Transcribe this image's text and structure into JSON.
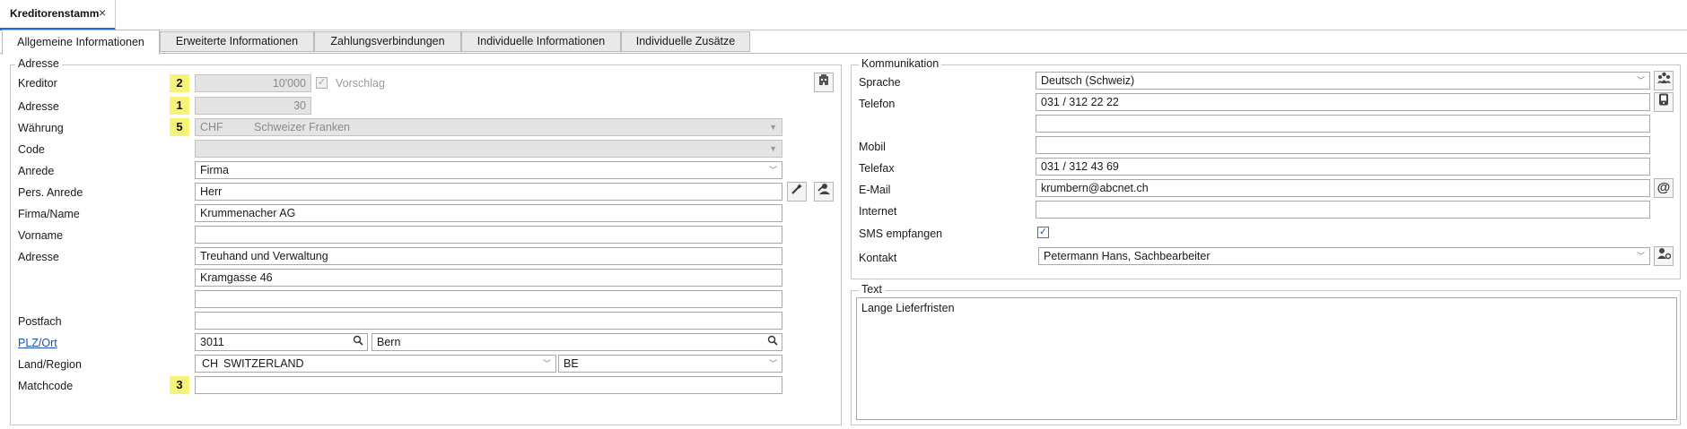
{
  "doc_tab": {
    "label": "Kreditorenstamm",
    "close": "×"
  },
  "tabs": [
    {
      "label": "Allgemeine Informationen"
    },
    {
      "label": "Erweiterte Informationen"
    },
    {
      "label": "Zahlungsverbindungen"
    },
    {
      "label": "Individuelle Informationen"
    },
    {
      "label": "Individuelle Zusätze"
    }
  ],
  "adresse": {
    "title": "Adresse",
    "kreditor": {
      "label": "Kreditor",
      "badge": "2",
      "value": "10'000",
      "vorschlag_label": "Vorschlag",
      "vorschlag_checked": true
    },
    "adresse_nr": {
      "label": "Adresse",
      "badge": "1",
      "value": "30"
    },
    "waehrung": {
      "label": "Währung",
      "badge": "5",
      "code": "CHF",
      "name": "Schweizer Franken"
    },
    "code": {
      "label": "Code",
      "value": ""
    },
    "anrede": {
      "label": "Anrede",
      "value": "Firma"
    },
    "pers_anrede": {
      "label": "Pers. Anrede",
      "value": "Herr"
    },
    "firma": {
      "label": "Firma/Name",
      "value": "Krummenacher AG"
    },
    "vorname": {
      "label": "Vorname",
      "value": ""
    },
    "adresse_text": {
      "label": "Adresse",
      "line1": "Treuhand und Verwaltung",
      "line2": "Kramgasse 46",
      "line3": ""
    },
    "postfach": {
      "label": "Postfach",
      "value": ""
    },
    "plz_ort": {
      "label": "PLZ/Ort",
      "plz": "3011",
      "ort": "Bern"
    },
    "land": {
      "label": "Land/Region",
      "code": "CH",
      "name": "SWITZERLAND",
      "region": "BE"
    },
    "matchcode": {
      "label": "Matchcode",
      "badge": "3",
      "value": ""
    }
  },
  "kommunikation": {
    "title": "Kommunikation",
    "sprache": {
      "label": "Sprache",
      "value": "Deutsch (Schweiz)"
    },
    "telefon": {
      "label": "Telefon",
      "value": "031 / 312 22 22",
      "value2": ""
    },
    "mobil": {
      "label": "Mobil",
      "value": ""
    },
    "telefax": {
      "label": "Telefax",
      "value": "031 / 312 43 69"
    },
    "email": {
      "label": "E-Mail",
      "value": "krumbern@abcnet.ch",
      "icon": "@"
    },
    "internet": {
      "label": "Internet",
      "value": ""
    },
    "sms": {
      "label": "SMS empfangen",
      "checked": true
    },
    "kontakt": {
      "label": "Kontakt",
      "value": "Petermann Hans, Sachbearbeiter"
    }
  },
  "text_group": {
    "title": "Text",
    "value": "Lange Lieferfristen"
  },
  "icons": {
    "building": "building-icon",
    "wand": "wand-icon",
    "person_edit": "person-edit-icon",
    "people": "people-icon",
    "phone": "phone-icon",
    "at": "at-icon",
    "person_gear": "person-gear-icon",
    "search": "search-icon",
    "chevron": "chevron-down-icon",
    "check": "check-icon"
  },
  "colors": {
    "accent": "#1e6fd0",
    "badge": "#f6f27a",
    "link": "#1f4fb0",
    "disabled_bg": "#e4e4e4"
  }
}
